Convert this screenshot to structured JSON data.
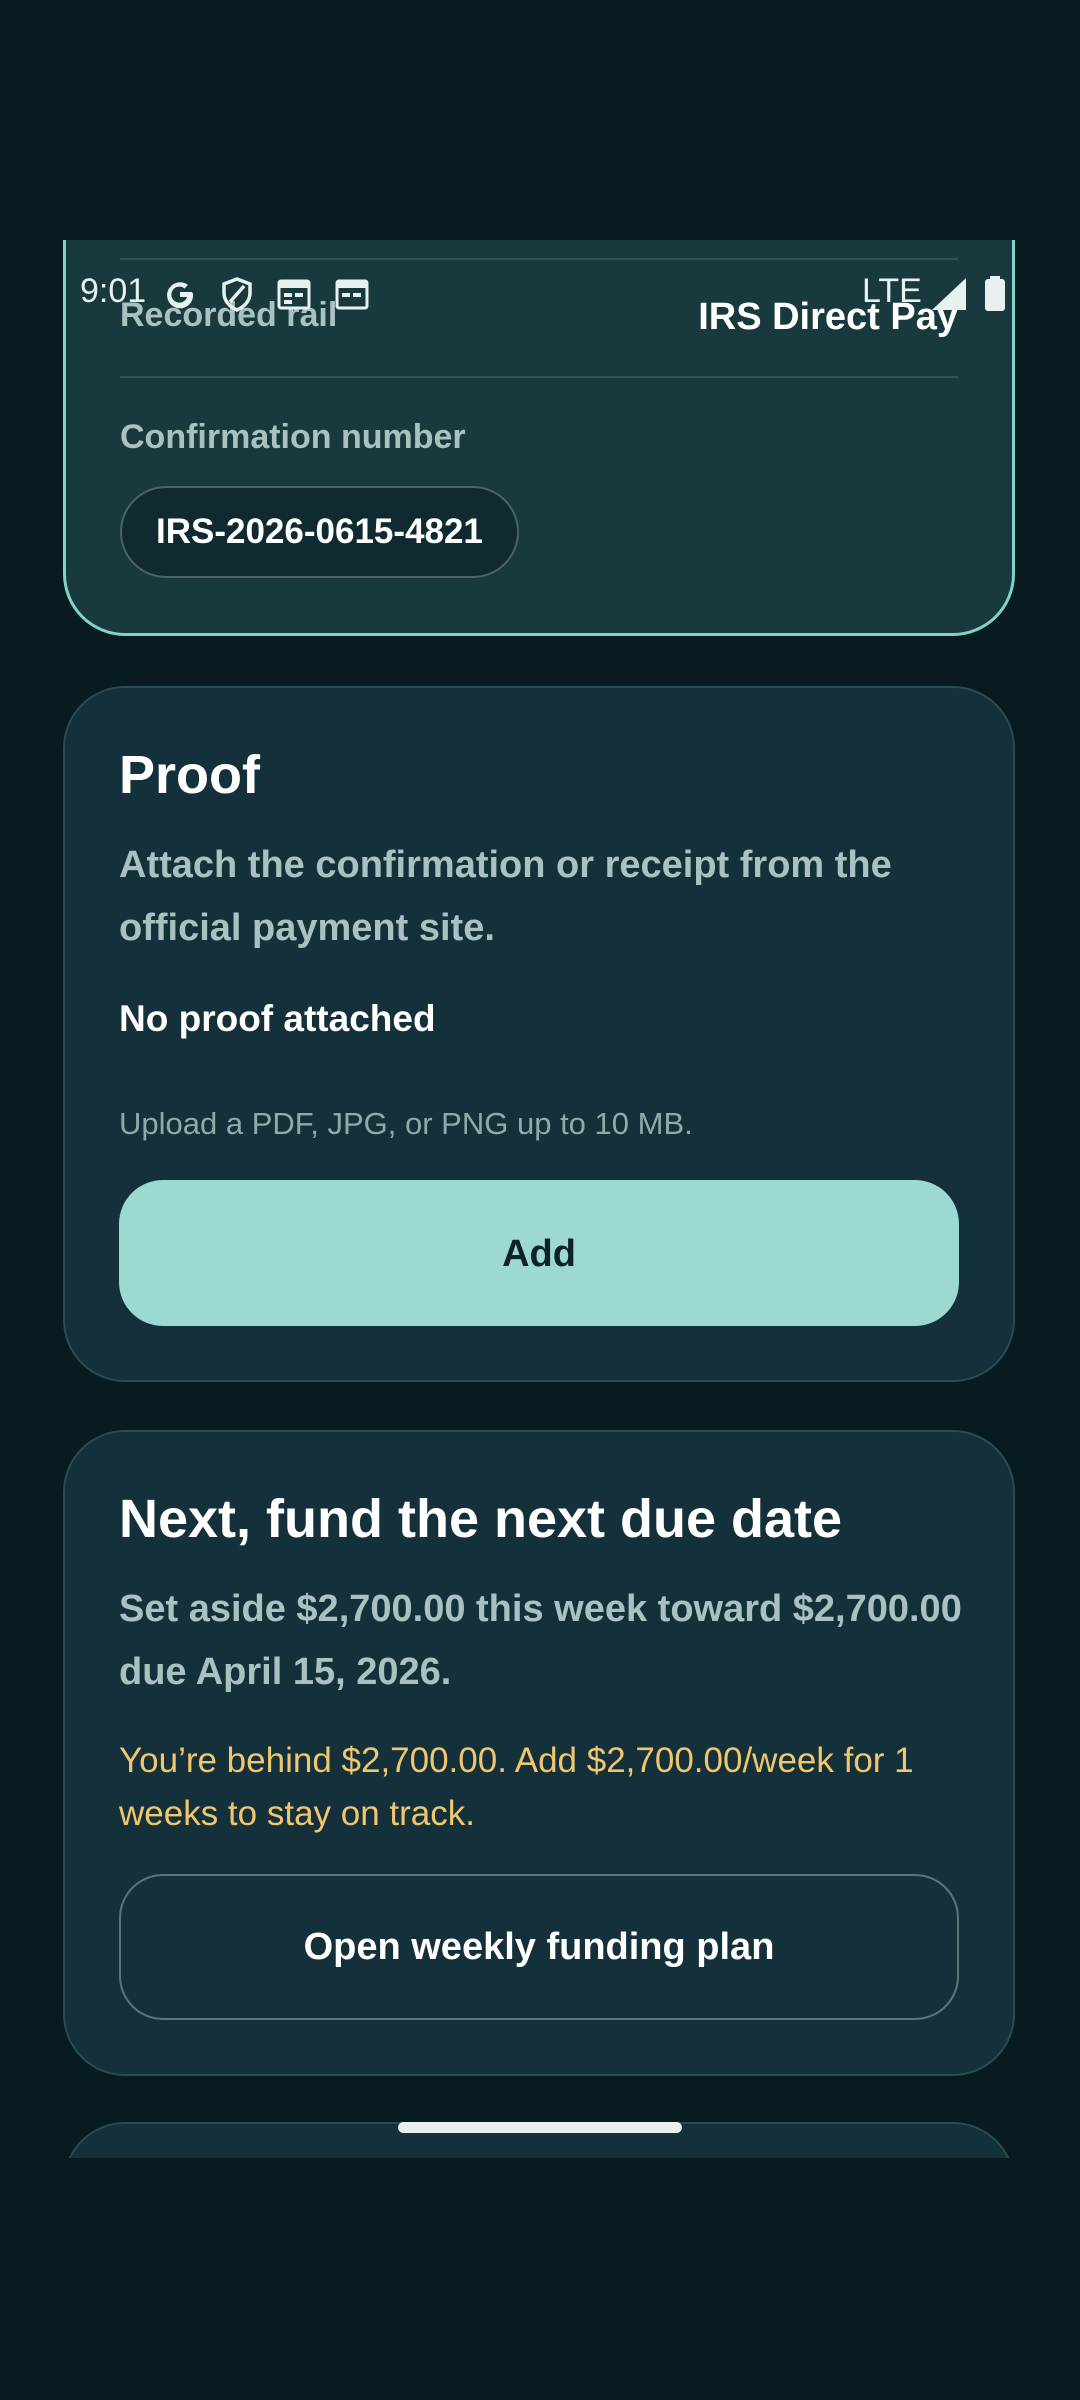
{
  "status_bar": {
    "time": "9:01",
    "network": "LTE",
    "icons": [
      "google-icon",
      "shield-icon",
      "calendar-icon",
      "calendar-icon",
      "signal-icon",
      "battery-icon"
    ]
  },
  "record_card": {
    "rail_label": "Recorded rail",
    "rail_value": "IRS Direct Pay",
    "confirmation_label": "Confirmation number",
    "confirmation_value": "IRS-2026-0615-4821"
  },
  "proof_card": {
    "title": "Proof",
    "description": "Attach the confirmation or receipt from the official payment site.",
    "status": "No proof attached",
    "hint": "Upload a PDF, JPG, or PNG up to 10 MB.",
    "add_button": "Add"
  },
  "next_card": {
    "title": "Next, fund the next due date",
    "description": "Set aside $2,700.00 this week toward $2,700.00 due April 15, 2026.",
    "warning": "You’re behind $2,700.00. Add $2,700.00/week for 1 weeks to stay on track.",
    "plan_button": "Open weekly funding plan"
  },
  "colors": {
    "background": "#071b21",
    "card": "#14303a",
    "accent": "#9dd9d3",
    "warning": "#f0c66e"
  }
}
